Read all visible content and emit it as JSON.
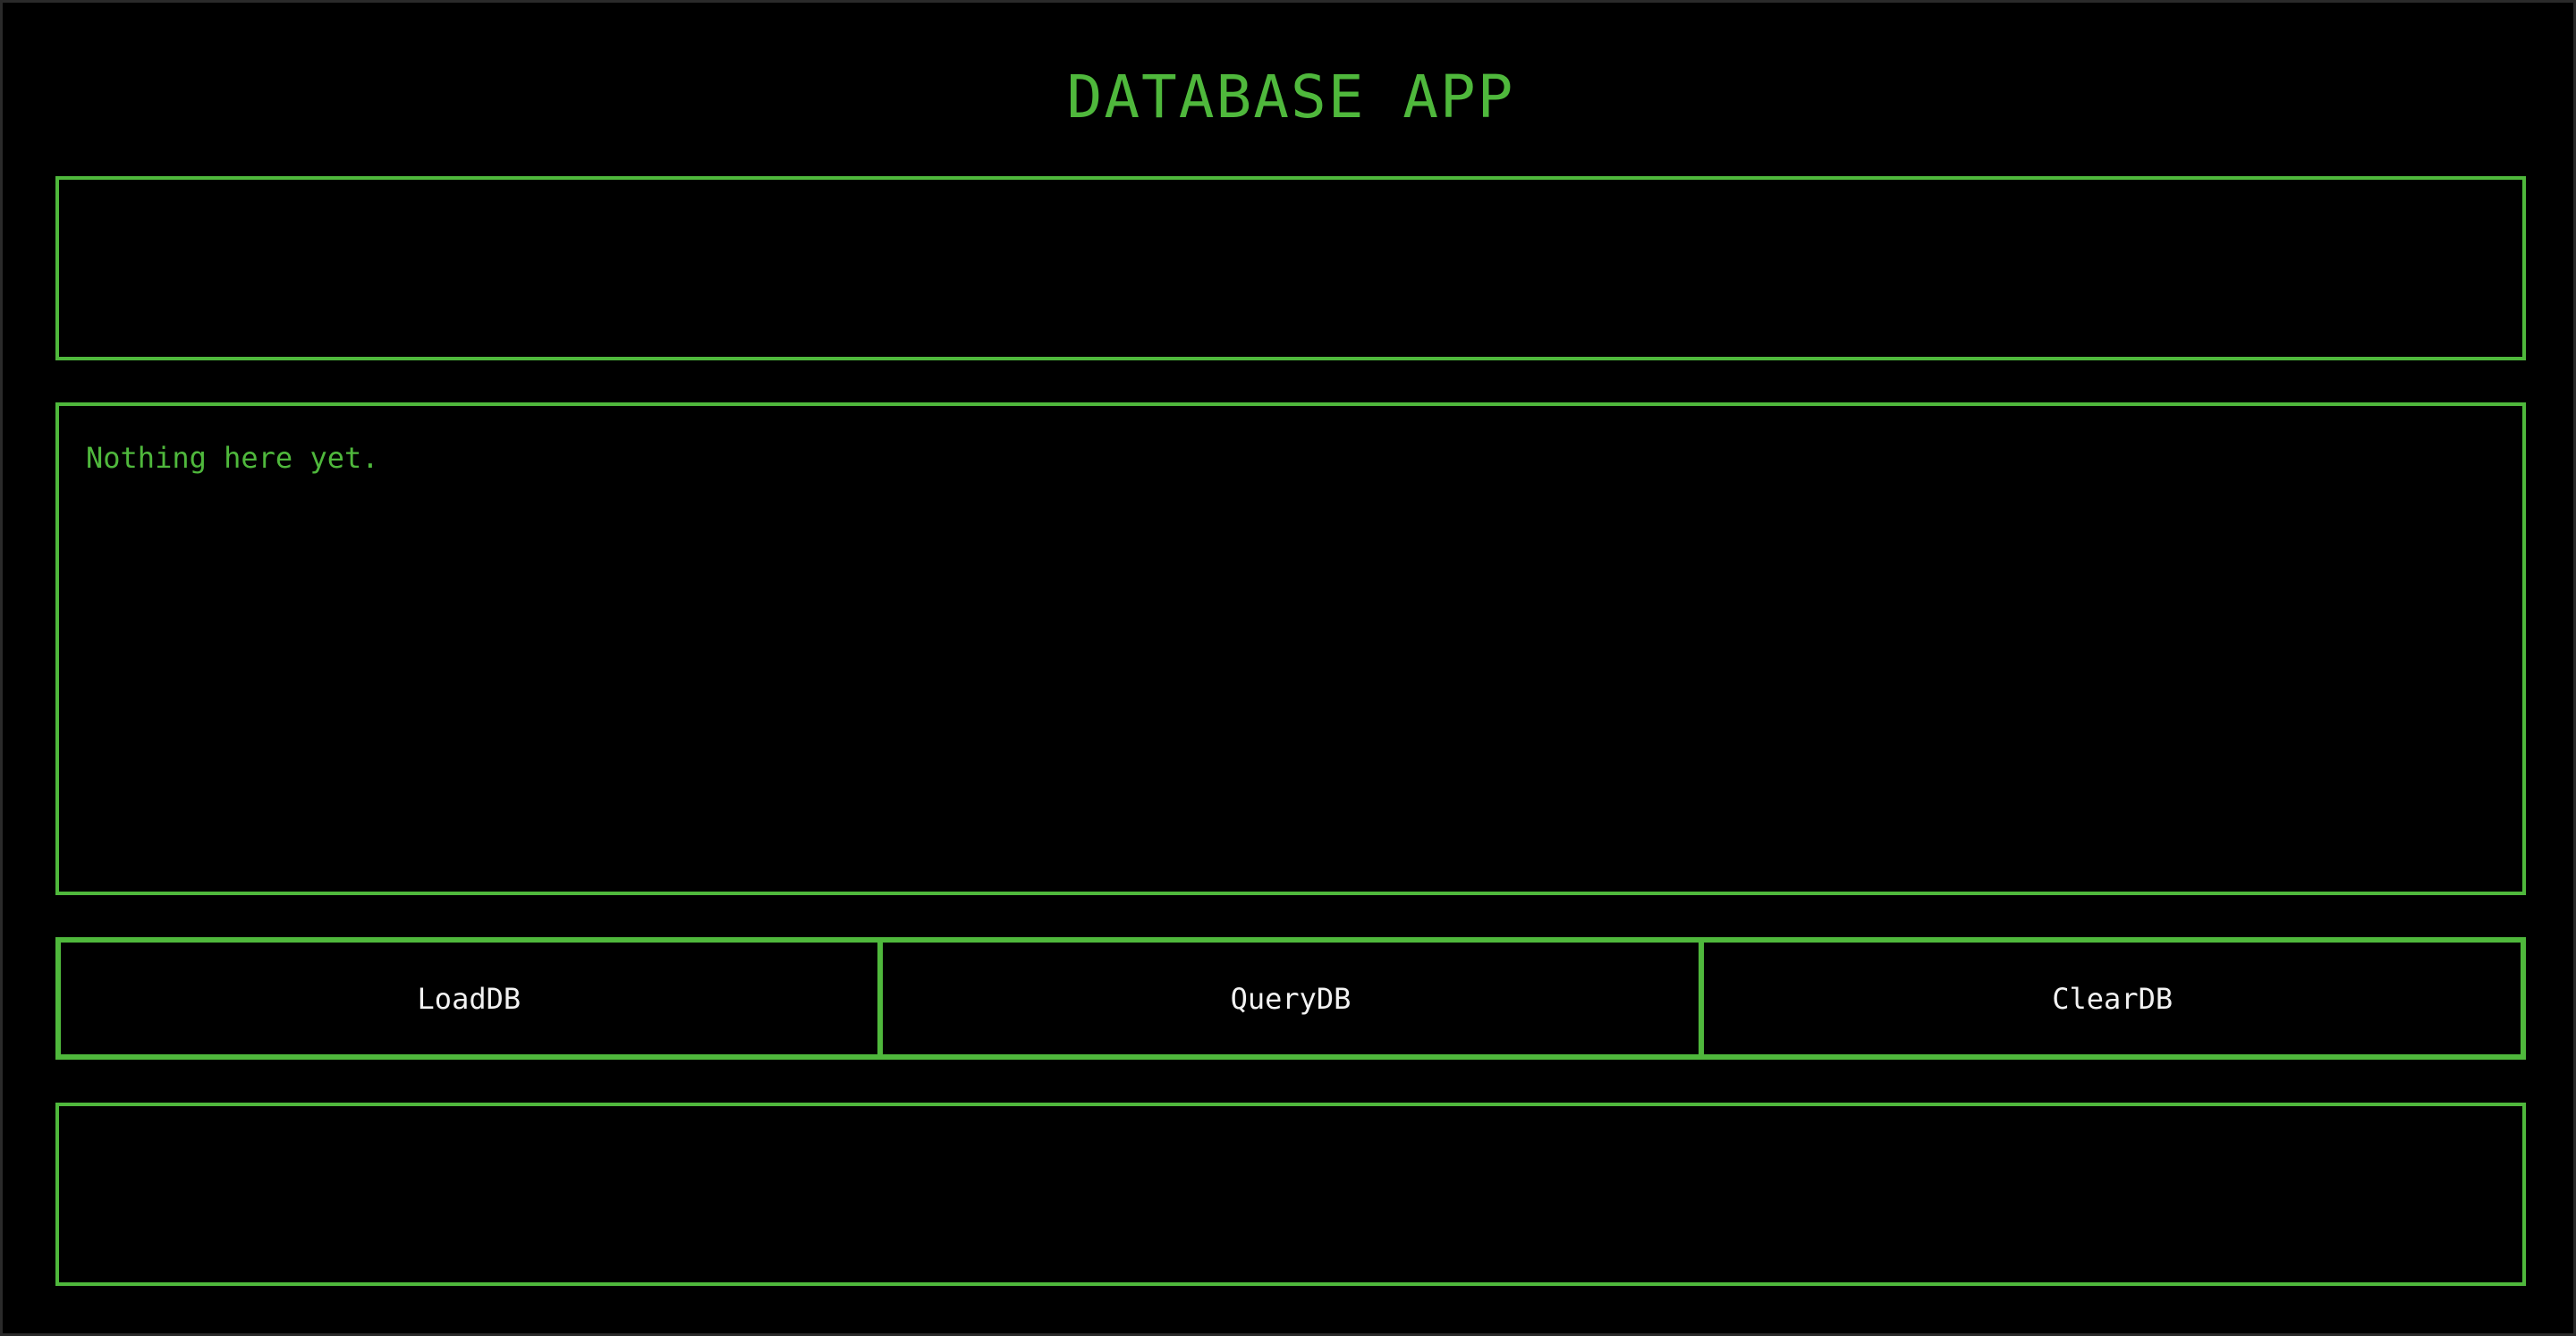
{
  "app": {
    "title": "DATABASE APP"
  },
  "output": {
    "text": "Nothing here yet."
  },
  "buttons": [
    {
      "label": "LoadDB"
    },
    {
      "label": "QueryDB"
    },
    {
      "label": "ClearDB"
    }
  ],
  "colors": {
    "accent": "#4fb83c",
    "background": "#000000",
    "button_text": "#f2f2f2"
  }
}
